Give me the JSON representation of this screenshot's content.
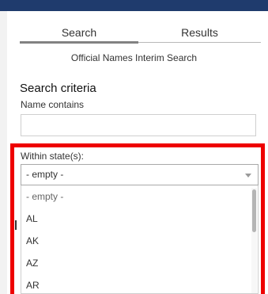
{
  "tabs": {
    "search": "Search",
    "results": "Results"
  },
  "subtitle": "Official Names Interim Search",
  "search_criteria": {
    "title": "Search criteria",
    "name_label": "Name contains",
    "name_value": ""
  },
  "state_filter": {
    "label": "Within state(s):",
    "selected": "- empty -",
    "options": [
      "- empty -",
      "AL",
      "AK",
      "AZ",
      "AR"
    ]
  },
  "colors": {
    "header_strip": "#1f3b6d",
    "highlight": "#ee0000"
  }
}
